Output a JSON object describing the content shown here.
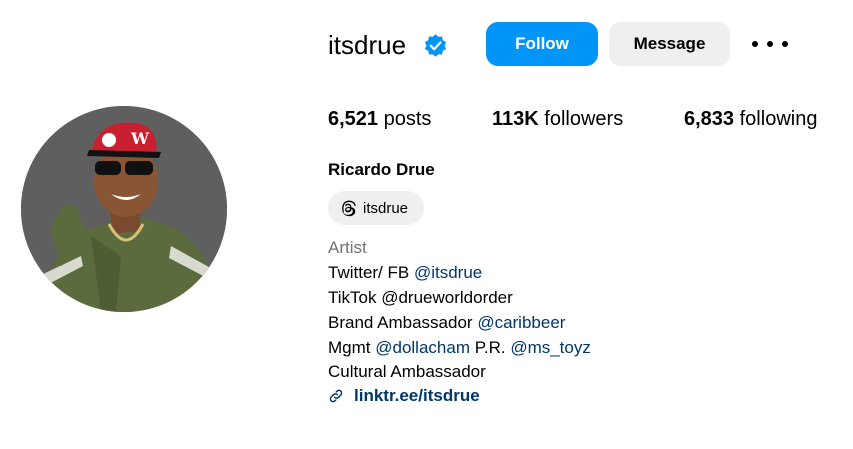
{
  "profile": {
    "username": "itsdrue",
    "verified_icon": "verified-badge-icon",
    "follow_label": "Follow",
    "message_label": "Message",
    "more_icon": "more-options-icon",
    "avatar_icon": "profile-photo"
  },
  "stats": {
    "posts_count": "6,521",
    "posts_label": "posts",
    "followers_count": "113K",
    "followers_label": "followers",
    "following_count": "6,833",
    "following_label": "following"
  },
  "bio": {
    "full_name": "Ricardo Drue",
    "threads_handle": "itsdrue",
    "category": "Artist",
    "line1_text": "Twitter/ FB ",
    "line1_mention": "@itsdrue",
    "line2_text": "TikTok @drueworldorder",
    "line3_text": "Brand Ambassador ",
    "line3_mention": "@caribbeer",
    "line4_text": "Mgmt ",
    "line4_mention1": "@dollacham",
    "line4_mid": " P.R. ",
    "line4_mention2": "@ms_toyz",
    "line5_text": "Cultural Ambassador",
    "link": "linktr.ee/itsdrue"
  },
  "colors": {
    "primary_blue": "#0095f6",
    "mention_blue": "#00376b",
    "button_gray": "#efefef",
    "muted_text": "#737373"
  }
}
